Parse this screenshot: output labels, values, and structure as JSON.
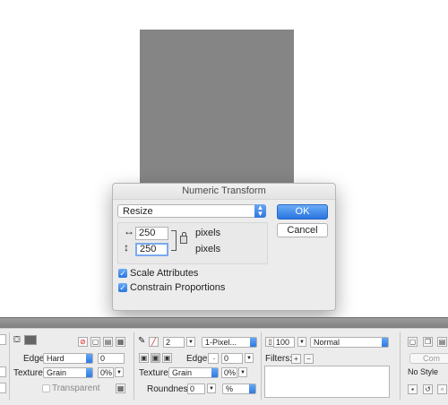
{
  "dialog": {
    "title": "Numeric Transform",
    "mode": "Resize",
    "width_value": "250",
    "height_value": "250",
    "unit_label": "pixels",
    "ok_label": "OK",
    "cancel_label": "Cancel",
    "scale_attributes_label": "Scale Attributes",
    "scale_attributes_checked": true,
    "constrain_proportions_label": "Constrain Proportions",
    "constrain_proportions_checked": true
  },
  "inspector": {
    "fill": {
      "edge_label": "Edge:",
      "edge_value": "Hard",
      "edge_amount": "0",
      "texture_label": "Texture:",
      "texture_value": "Grain",
      "texture_percent": "0%",
      "transparent_label": "Transparent"
    },
    "stroke": {
      "size_value": "2",
      "stroke_type": "1-Pixel...",
      "edge_label": "Edge:",
      "edge_amount": "0",
      "texture_label": "Texture:",
      "texture_value": "Grain",
      "texture_percent": "0%",
      "roundness_label": "Roundness:",
      "roundness_value": "0",
      "roundness_unit": "%"
    },
    "effects": {
      "opacity_value": "100",
      "blend_mode": "Normal",
      "filters_label": "Filters:"
    },
    "style": {
      "style_value": "No Style",
      "partial_label": "Com"
    }
  },
  "colors": {
    "canvas_shape": "#858585",
    "accent_blue": "#2a75e0",
    "dialog_bg": "#ececec"
  }
}
